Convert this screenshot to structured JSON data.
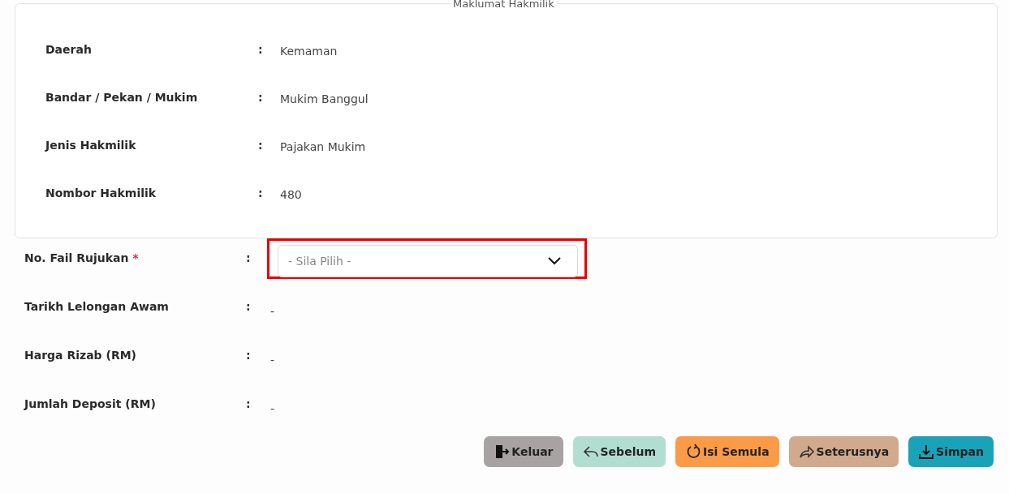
{
  "section": {
    "legend": "Maklumat Hakmilik",
    "rows": [
      {
        "label": "Daerah",
        "separator": ":",
        "value": "Kemaman"
      },
      {
        "label": "Bandar / Pekan / Mukim",
        "separator": ":",
        "value": "Mukim Banggul"
      },
      {
        "label": "Jenis Hakmilik",
        "separator": ":",
        "value": "Pajakan Mukim"
      },
      {
        "label": "Nombor Hakmilik",
        "separator": ":",
        "value": "480"
      }
    ]
  },
  "form": [
    {
      "kind": "select",
      "label": "No. Fail Rujukan",
      "required_mark": "*",
      "separator": ":",
      "placeholder": "- Sila Pilih -",
      "highlighted": true
    },
    {
      "kind": "text",
      "label": "Tarikh Lelongan Awam",
      "separator": ":",
      "value": "-"
    },
    {
      "kind": "text",
      "label": "Harga Rizab (RM)",
      "separator": ":",
      "value": "-"
    },
    {
      "kind": "text",
      "label": "Jumlah Deposit (RM)",
      "separator": ":",
      "value": "-"
    }
  ],
  "buttons": [
    {
      "label": "Keluar",
      "kind": "exit",
      "color": "#a8a3a3"
    },
    {
      "label": "Sebelum",
      "kind": "back",
      "color": "#b2ded2"
    },
    {
      "label": "Isi Semula",
      "kind": "reload",
      "color": "#fb9b47"
    },
    {
      "label": "Seterusnya",
      "kind": "forward",
      "color": "#d1a98c"
    },
    {
      "label": "Simpan",
      "kind": "save",
      "color": "#1aa2b8"
    }
  ]
}
